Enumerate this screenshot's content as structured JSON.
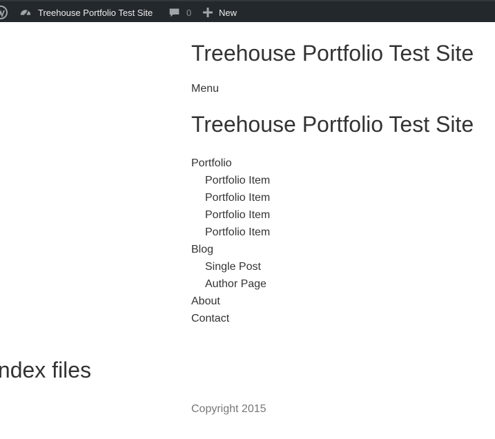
{
  "admin_bar": {
    "wp_logo_icon": "wordpress-logo-icon",
    "site_icon": "dashboard-icon",
    "site_name": "Treehouse Portfolio Test Site",
    "comments_icon": "comment-bubble-icon",
    "comments_count": "0",
    "new_icon": "plus-icon",
    "new_label": "New",
    "background": "#23282d"
  },
  "header": {
    "site_title": "Treehouse Portfolio Test Site",
    "menu_label": "Menu"
  },
  "nav": {
    "title": "Treehouse Portfolio Test Site",
    "items": [
      {
        "label": "Portfolio",
        "level": 0
      },
      {
        "label": "Portfolio Item",
        "level": 1
      },
      {
        "label": "Portfolio Item",
        "level": 1
      },
      {
        "label": "Portfolio Item",
        "level": 1
      },
      {
        "label": "Portfolio Item",
        "level": 1
      },
      {
        "label": "Blog",
        "level": 0
      },
      {
        "label": "Single Post",
        "level": 1
      },
      {
        "label": "Author Page",
        "level": 1
      },
      {
        "label": "About",
        "level": 0
      },
      {
        "label": "Contact",
        "level": 0
      }
    ]
  },
  "main": {
    "heading": "Index files"
  },
  "footer": {
    "copyright": "Copyright 2015"
  }
}
